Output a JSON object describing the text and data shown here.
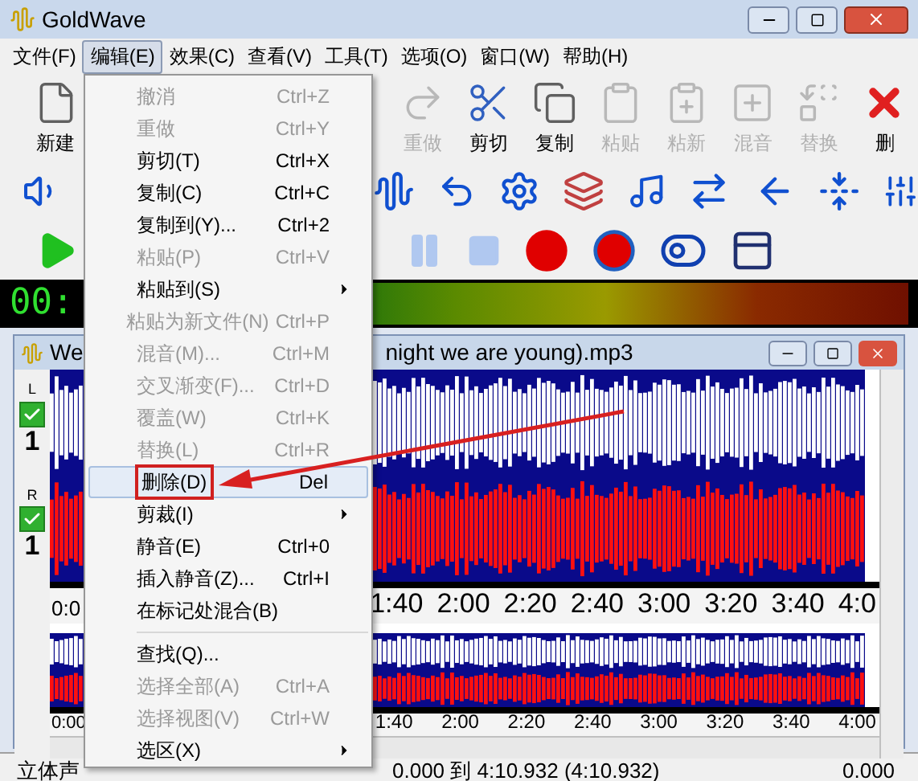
{
  "window": {
    "title": "GoldWave"
  },
  "menu_bar": [
    {
      "label": "文件(F)",
      "selected": false
    },
    {
      "label": "编辑(E)",
      "selected": true
    },
    {
      "label": "效果(C)",
      "selected": false
    },
    {
      "label": "查看(V)",
      "selected": false
    },
    {
      "label": "工具(T)",
      "selected": false
    },
    {
      "label": "选项(O)",
      "selected": false
    },
    {
      "label": "窗口(W)",
      "selected": false
    },
    {
      "label": "帮助(H)",
      "selected": false
    }
  ],
  "toolbar": [
    {
      "kind": "new",
      "label": "新建",
      "disabled": false
    },
    {
      "kind": "redo",
      "label": "重做",
      "disabled": true
    },
    {
      "kind": "cut",
      "label": "剪切",
      "disabled": false
    },
    {
      "kind": "copy",
      "label": "复制",
      "disabled": false
    },
    {
      "kind": "paste",
      "label": "粘贴",
      "disabled": true
    },
    {
      "kind": "pastenew",
      "label": "粘新",
      "disabled": true
    },
    {
      "kind": "mix",
      "label": "混音",
      "disabled": true
    },
    {
      "kind": "replace",
      "label": "替换",
      "disabled": true
    },
    {
      "kind": "delete",
      "label": "删",
      "disabled": false
    }
  ],
  "time_display": "00:",
  "edit_menu": [
    {
      "kind": "item",
      "label": "撤消",
      "shortcut": "Ctrl+Z",
      "disabled": true,
      "selected": false
    },
    {
      "kind": "item",
      "label": "重做",
      "shortcut": "Ctrl+Y",
      "disabled": true,
      "selected": false
    },
    {
      "kind": "item",
      "label": "剪切(T)",
      "shortcut": "Ctrl+X",
      "disabled": false,
      "selected": false
    },
    {
      "kind": "item",
      "label": "复制(C)",
      "shortcut": "Ctrl+C",
      "disabled": false,
      "selected": false
    },
    {
      "kind": "item",
      "label": "复制到(Y)...",
      "shortcut": "Ctrl+2",
      "disabled": false,
      "selected": false
    },
    {
      "kind": "item",
      "label": "粘贴(P)",
      "shortcut": "Ctrl+V",
      "disabled": true,
      "selected": false
    },
    {
      "kind": "submenu",
      "label": "粘贴到(S)",
      "disabled": false,
      "selected": false
    },
    {
      "kind": "item",
      "label": "粘贴为新文件(N)",
      "shortcut": "Ctrl+P",
      "disabled": true,
      "selected": false
    },
    {
      "kind": "item",
      "label": "混音(M)...",
      "shortcut": "Ctrl+M",
      "disabled": true,
      "selected": false
    },
    {
      "kind": "item",
      "label": "交叉渐变(F)...",
      "shortcut": "Ctrl+D",
      "disabled": true,
      "selected": false
    },
    {
      "kind": "item",
      "label": "覆盖(W)",
      "shortcut": "Ctrl+K",
      "disabled": true,
      "selected": false
    },
    {
      "kind": "item",
      "label": "替换(L)",
      "shortcut": "Ctrl+R",
      "disabled": true,
      "selected": false
    },
    {
      "kind": "item",
      "label": "删除(D)",
      "shortcut": "Del",
      "disabled": false,
      "selected": true
    },
    {
      "kind": "submenu",
      "label": "剪裁(I)",
      "disabled": false,
      "selected": false
    },
    {
      "kind": "item",
      "label": "静音(E)",
      "shortcut": "Ctrl+0",
      "disabled": false,
      "selected": false
    },
    {
      "kind": "item",
      "label": "插入静音(Z)...",
      "shortcut": "Ctrl+I",
      "disabled": false,
      "selected": false
    },
    {
      "kind": "item",
      "label": "在标记处混合(B)",
      "disabled": false,
      "selected": false
    },
    {
      "kind": "separator"
    },
    {
      "kind": "item",
      "label": "查找(Q)...",
      "disabled": false,
      "selected": false
    },
    {
      "kind": "item",
      "label": "选择全部(A)",
      "shortcut": "Ctrl+A",
      "disabled": true,
      "selected": false
    },
    {
      "kind": "item",
      "label": "选择视图(V)",
      "shortcut": "Ctrl+W",
      "disabled": true,
      "selected": false
    },
    {
      "kind": "submenu",
      "label": "选区(X)",
      "disabled": false,
      "selected": false
    }
  ],
  "document": {
    "title_left": "We",
    "title_right": "night we are young).mp3",
    "channels": [
      {
        "label": "L",
        "number": "1",
        "checked": true
      },
      {
        "label": "R",
        "number": "1",
        "checked": true
      }
    ],
    "ruler_start": "0:0",
    "ruler": [
      "1:40",
      "2:00",
      "2:20",
      "2:40",
      "3:00",
      "3:20",
      "3:40",
      "4:0"
    ],
    "overview_start": "0:00",
    "overview_ruler": [
      "1:40",
      "2:00",
      "2:20",
      "2:40",
      "3:00",
      "3:20",
      "3:40",
      "4:00"
    ]
  },
  "status_bar": {
    "channels": "立体声",
    "selection": "0.000 到 4:10.932 (4:10.932)",
    "value": "0.000"
  }
}
